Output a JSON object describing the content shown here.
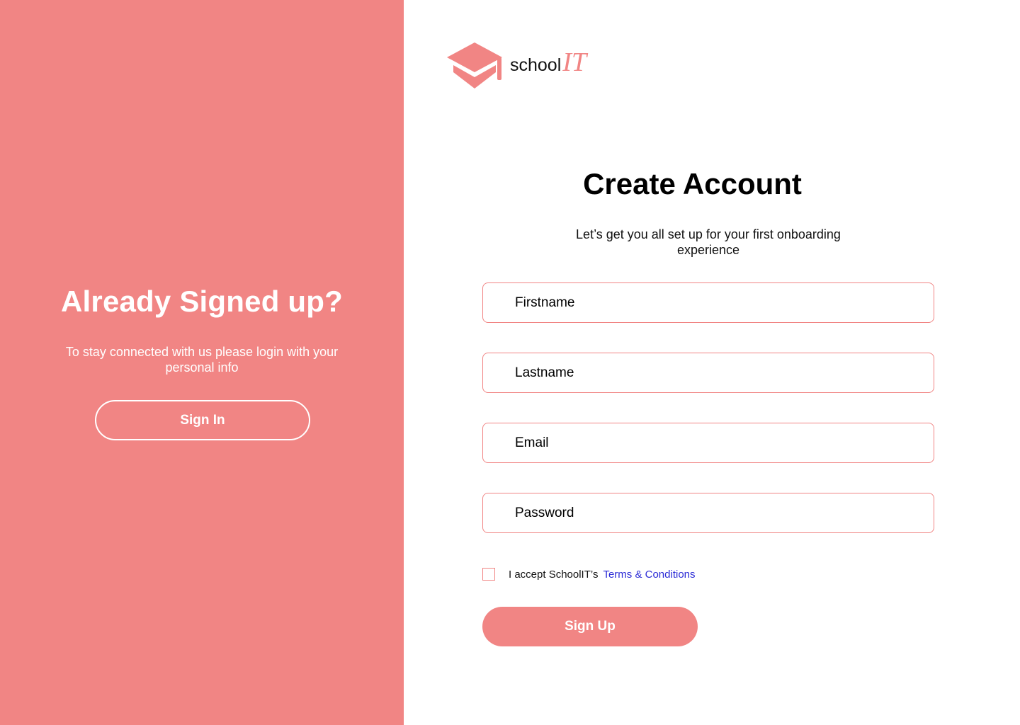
{
  "colors": {
    "accent": "#f18584",
    "link": "#2b2bd6",
    "text": "#000000",
    "background": "#ffffff"
  },
  "left_panel": {
    "title": "Already Signed up?",
    "subtitle": "To stay connected with us  please login with your personal info",
    "signin_label": "Sign In"
  },
  "logo": {
    "icon": "graduation-cap-icon",
    "school_text": "school",
    "it_text": "IT"
  },
  "form": {
    "title": "Create Account",
    "subtitle": "Let’s get you all set up for your first onboarding experience",
    "fields": {
      "firstname": {
        "placeholder": "Firstname",
        "value": ""
      },
      "lastname": {
        "placeholder": "Lastname",
        "value": ""
      },
      "email": {
        "placeholder": "Email",
        "value": ""
      },
      "password": {
        "placeholder": "Password",
        "value": ""
      }
    },
    "terms_prefix": "I accept SchoolIT’s",
    "terms_link": "Terms & Conditions",
    "terms_checked": false,
    "signup_label": "Sign Up"
  }
}
